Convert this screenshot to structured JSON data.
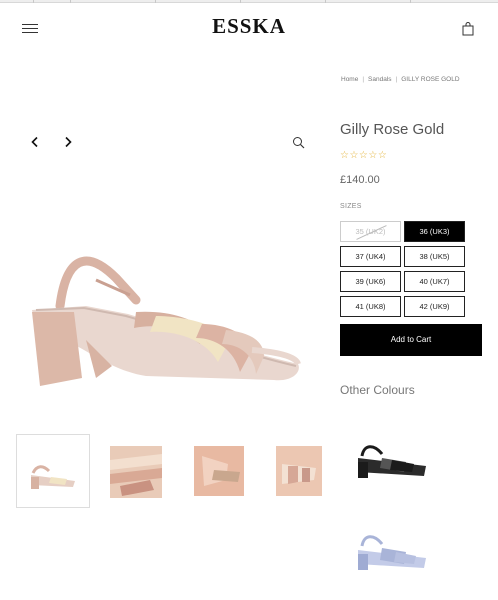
{
  "header": {
    "brand": "ESSKA",
    "menu_icon": "hamburger-menu-icon",
    "cart_icon": "shopping-bag-icon"
  },
  "breadcrumb": {
    "home": "Home",
    "separator": "|",
    "category": "Sandals",
    "current": "GILLY ROSE GOLD"
  },
  "product": {
    "title": "Gilly Rose Gold",
    "rating": {
      "stars_filled": 0,
      "stars_total": 5,
      "display": "☆☆☆☆☆"
    },
    "price": "£140.00",
    "sizes_label": "SIZES",
    "sizes": [
      {
        "label": "35 (UK2)",
        "available": false,
        "selected": false
      },
      {
        "label": "36 (UK3)",
        "available": true,
        "selected": true
      },
      {
        "label": "37 (UK4)",
        "available": true,
        "selected": false
      },
      {
        "label": "38 (UK5)",
        "available": true,
        "selected": false
      },
      {
        "label": "39 (UK6)",
        "available": true,
        "selected": false
      },
      {
        "label": "40 (UK7)",
        "available": true,
        "selected": false
      },
      {
        "label": "41 (UK8)",
        "available": true,
        "selected": false
      },
      {
        "label": "42 (UK9)",
        "available": true,
        "selected": false
      }
    ],
    "add_to_cart": "Add to Cart",
    "other_colours": "Other Colours"
  },
  "gallery": {
    "prev_icon": "chevron-left-icon",
    "next_icon": "chevron-right-icon",
    "zoom_icon": "magnifier-icon"
  },
  "colors": {
    "button_bg": "#000000",
    "star": "#e4b43c",
    "product_pink": "#dcb7a9",
    "product_cream": "#f1e4c4",
    "product_black": "#1b1b1b",
    "product_lilac": "#a9b4d8"
  }
}
